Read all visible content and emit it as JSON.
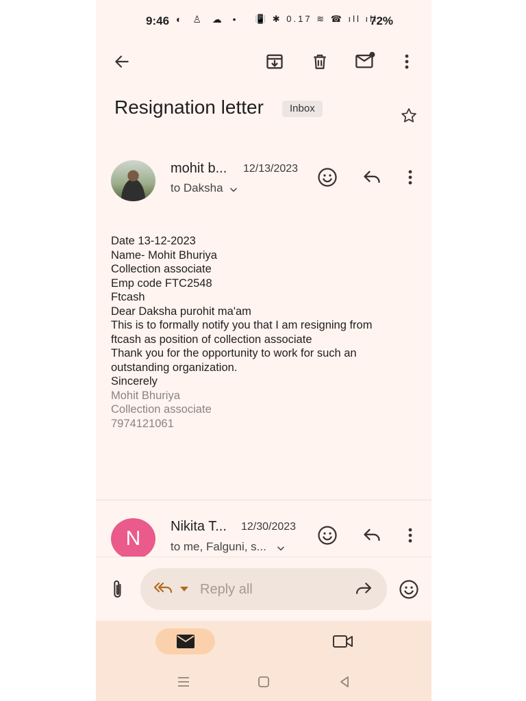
{
  "status_bar": {
    "time": "9:46",
    "left_icons": "◐ ♙ ☁ •",
    "right_icons": "📳 ✱ 0.17 ≋ ☎ ıll ıll ◌",
    "battery": "72%"
  },
  "toolbar": {
    "back_icon": "back-arrow-icon",
    "archive_icon": "archive-icon",
    "delete_icon": "trash-icon",
    "mark_unread_icon": "mail-unread-icon",
    "more_icon": "more-vert-icon"
  },
  "subject": {
    "title": "Resignation letter",
    "label": "Inbox"
  },
  "message1": {
    "sender": "mohit b...",
    "date": "12/13/2023",
    "recipients": "to Daksha",
    "body": [
      "Date 13-12-2023",
      "Name- Mohit Bhuriya",
      "Collection associate",
      "Emp code FTC2548",
      "Ftcash",
      "",
      "",
      "Dear Daksha purohit ma'am",
      "This is to formally notify you that I am resigning from",
      "ftcash as position of collection associate",
      "",
      "Thank you for the opportunity to work for such an",
      "outstanding organization.",
      "",
      "Sincerely"
    ],
    "signature": [
      "Mohit Bhuriya",
      "Collection associate",
      "7974121061"
    ]
  },
  "message2": {
    "avatar_letter": "N",
    "sender": "Nikita T...",
    "date": "12/30/2023",
    "recipients": "to me, Falguni, s..."
  },
  "reply_bar": {
    "placeholder": "Reply all"
  },
  "colors": {
    "background": "#fff4f0",
    "nav_background": "#fbe5d6",
    "active_pill": "#fbd1ad",
    "reply_accent": "#b26a1e",
    "avatar_n": "#ea5a8a"
  }
}
